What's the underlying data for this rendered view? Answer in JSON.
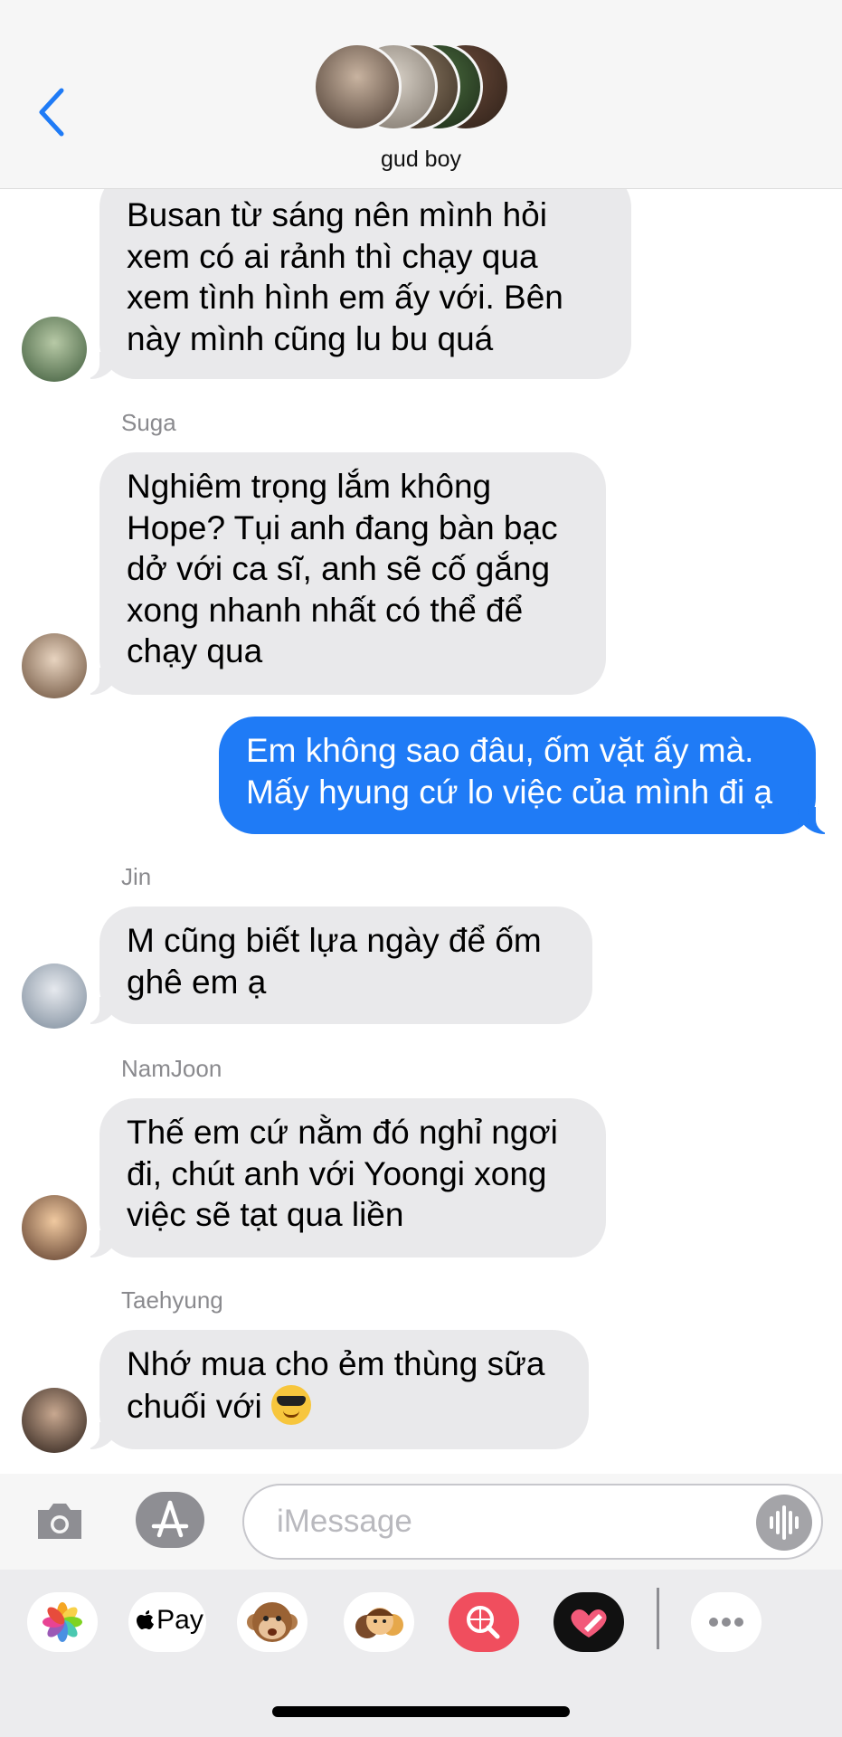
{
  "header": {
    "group_name": "gud boy",
    "back_icon": "chevron-left-icon",
    "accent_color": "#1f7bf6"
  },
  "messages": [
    {
      "direction": "incoming",
      "sender": "",
      "text": "Busan từ sáng nên mình hỏi\nxem có ai rảnh thì chạy qua\nxem tình hình em ấy với. Bên\nnày mình cũng lu bu quá"
    },
    {
      "direction": "incoming",
      "sender": "Suga",
      "text": "Nghiêm trọng lắm không\nHope? Tụi anh đang bàn bạc\ndở với ca sĩ, anh sẽ cố gắng\nxong nhanh nhất có thể để\nchạy qua"
    },
    {
      "direction": "outgoing",
      "sender": "",
      "text": "Em không sao đâu, ốm vặt ấy mà.\nMấy hyung cứ lo việc của mình đi ạ"
    },
    {
      "direction": "incoming",
      "sender": "Jin",
      "text": "M cũng biết lựa ngày để ốm\nghê em ạ"
    },
    {
      "direction": "incoming",
      "sender": "NamJoon",
      "text": "Thế em cứ nằm đó nghỉ ngơi\nđi, chút anh với Yoongi xong\nviệc sẽ tạt qua liền"
    },
    {
      "direction": "incoming",
      "sender": "Taehyung",
      "text_line1": "Nhớ mua cho ẻm thùng sữa",
      "text_line2": "chuối với",
      "emoji": "smiling-face-with-sunglasses-icon"
    }
  ],
  "compose": {
    "placeholder": "iMessage",
    "camera_icon": "camera-icon",
    "appstore_icon": "app-store-icon",
    "voice_icon": "audio-waveform-icon"
  },
  "app_drawer": {
    "apps": [
      "photos-icon",
      "apple-pay-icon",
      "animoji-icon",
      "memoji-icon",
      "image-search-icon",
      "digital-touch-icon",
      "more-apps-icon"
    ],
    "apple_pay_label": "Pay"
  }
}
